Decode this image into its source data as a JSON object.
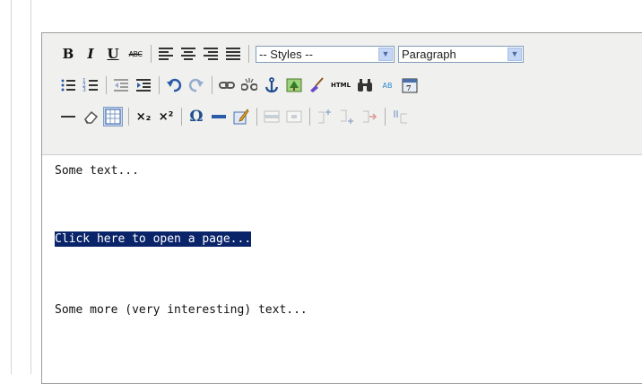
{
  "toolbar": {
    "row1": {
      "bold": "B",
      "italic": "I",
      "underline": "U",
      "strikethrough": "ABC",
      "styles_select": "-- Styles --",
      "format_select": "Paragraph"
    },
    "row2": {
      "html_button": "HTML",
      "replace_glyph": "AB"
    },
    "row3": {
      "subscript_glyph": "×₂",
      "superscript_glyph": "×²",
      "special_char": "Ω"
    }
  },
  "content": {
    "paragraph1": "Some text...",
    "link_text": "Click here to open a page...",
    "paragraph3": "Some more (very interesting) text..."
  },
  "colors": {
    "toolbar_bg": "#f0f0ee",
    "selection_bg": "#0a246a",
    "active_button_bg": "#c9d6ea"
  }
}
